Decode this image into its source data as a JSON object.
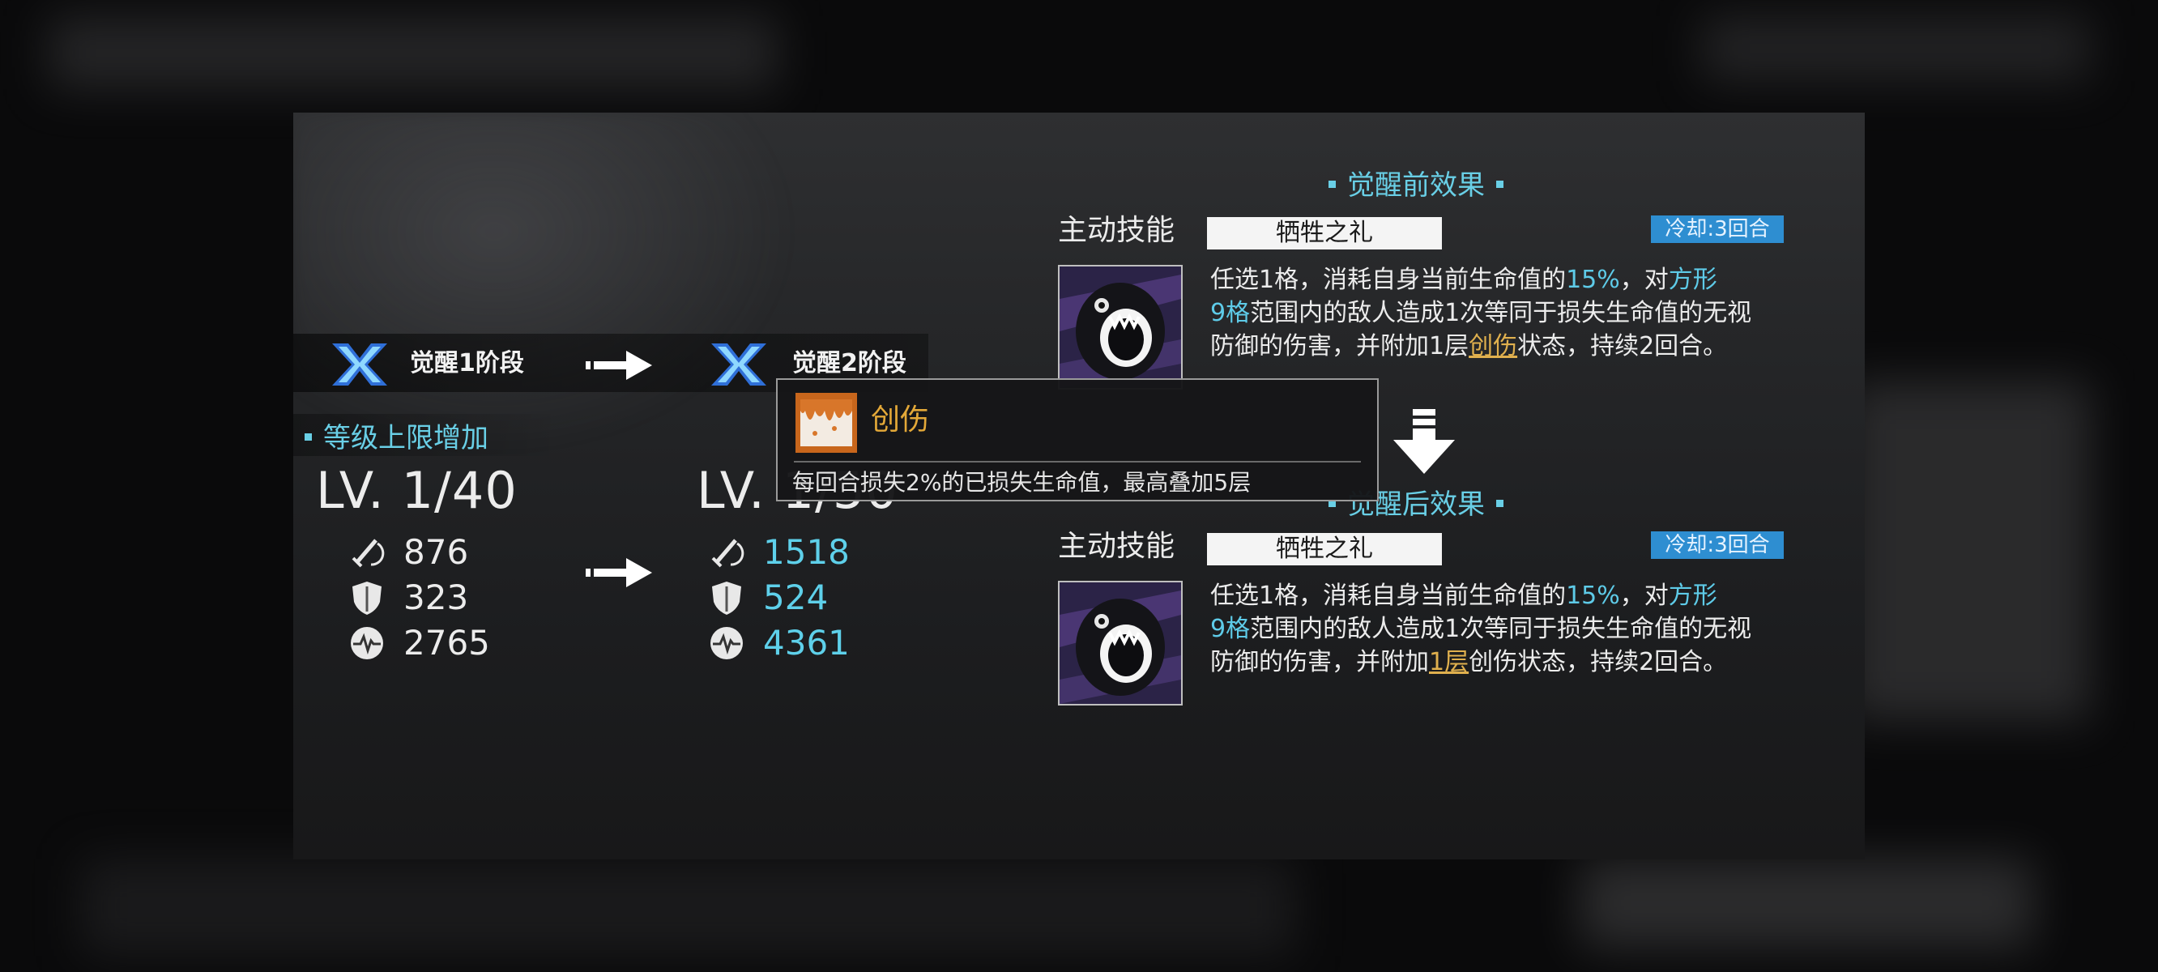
{
  "stages": {
    "from_label": "觉醒1阶段",
    "to_label": "觉醒2阶段"
  },
  "level_section": {
    "title": "等级上限增加",
    "before_level": "LV. 1/40",
    "after_level": "LV. 1/50"
  },
  "stats": {
    "before": [
      {
        "icon": "attack-sword-icon",
        "value": "876"
      },
      {
        "icon": "defense-shield-icon",
        "value": "323"
      },
      {
        "icon": "health-heartbeat-icon",
        "value": "2765"
      }
    ],
    "after": [
      {
        "icon": "attack-sword-icon",
        "value": "1518"
      },
      {
        "icon": "defense-shield-icon",
        "value": "524"
      },
      {
        "icon": "health-heartbeat-icon",
        "value": "4361"
      }
    ]
  },
  "before_effect": {
    "title": "觉醒前效果",
    "skill_type": "主动技能",
    "skill_name": "牺牲之礼",
    "cooldown": "冷却:3回合",
    "desc": {
      "l1a": "任选1格，消耗自身当前生命值的",
      "l1b": "15%",
      "l1c": "，对",
      "l1d": "方形",
      "l2a": "9格",
      "l2b": "范围内的敌人造成1次等同于损失生命值的无视",
      "l3a": "防御的伤害，并附加1层",
      "l3b": "创伤",
      "l3c": "状态，持续2回合。"
    }
  },
  "after_effect": {
    "title": "觉醒后效果",
    "skill_type": "主动技能",
    "skill_name": "牺牲之礼",
    "cooldown": "冷却:3回合",
    "desc": {
      "l1a": "任选1格，消耗自身当前生命值的",
      "l1b": "15%",
      "l1c": "，对",
      "l1d": "方形",
      "l2a": "9格",
      "l2b": "范围内的敌人造成1次等同于损失生命值的无视",
      "l3a": "防御的伤害，并附加",
      "l3b": "1层",
      "l3c": "创伤状态，持续2回合。"
    }
  },
  "tooltip": {
    "icon": "wound-blood-drip-icon",
    "title": "创伤",
    "desc": "每回合损失2%的已损失生命值，最高叠加5层"
  },
  "colors": {
    "accent_cyan": "#5ecbe8",
    "keyword_gold": "#e0b04e",
    "cooldown_blue": "#2e8ed1"
  }
}
